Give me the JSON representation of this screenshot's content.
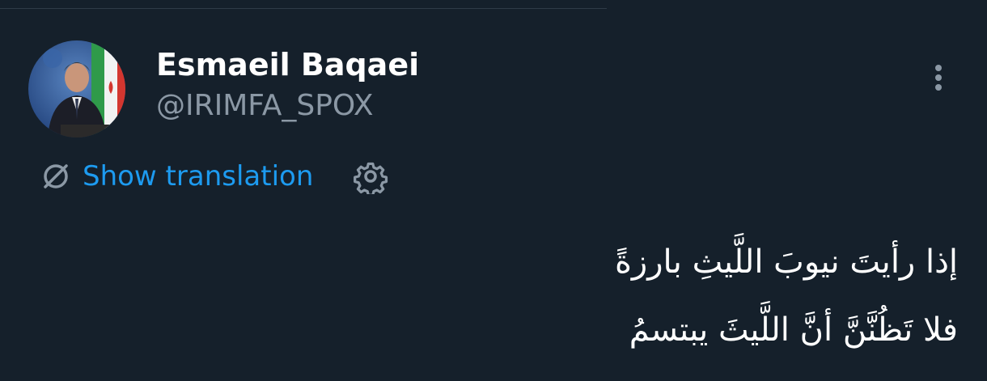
{
  "colors": {
    "background": "#15202b",
    "name_text": "#ffffff",
    "handle_text": "#8b98a5",
    "link_blue": "#1d9bf0",
    "icon_gray": "#8b98a5"
  },
  "author": {
    "display_name": "Esmaeil Baqaei",
    "handle": "@IRIMFA_SPOX",
    "avatar_icon": "profile-photo"
  },
  "actions": {
    "more_icon": "more-vertical-icon",
    "translation_icon": "translate-globe-icon",
    "show_translation_label": "Show translation",
    "settings_icon": "gear-icon"
  },
  "tweet": {
    "lines": [
      "إذا رأيتَ نيوبَ اللَّيثِ بارزةً",
      "فلا تَظُنَّنَّ أنَّ اللَّيثَ يبتسمُ"
    ]
  }
}
